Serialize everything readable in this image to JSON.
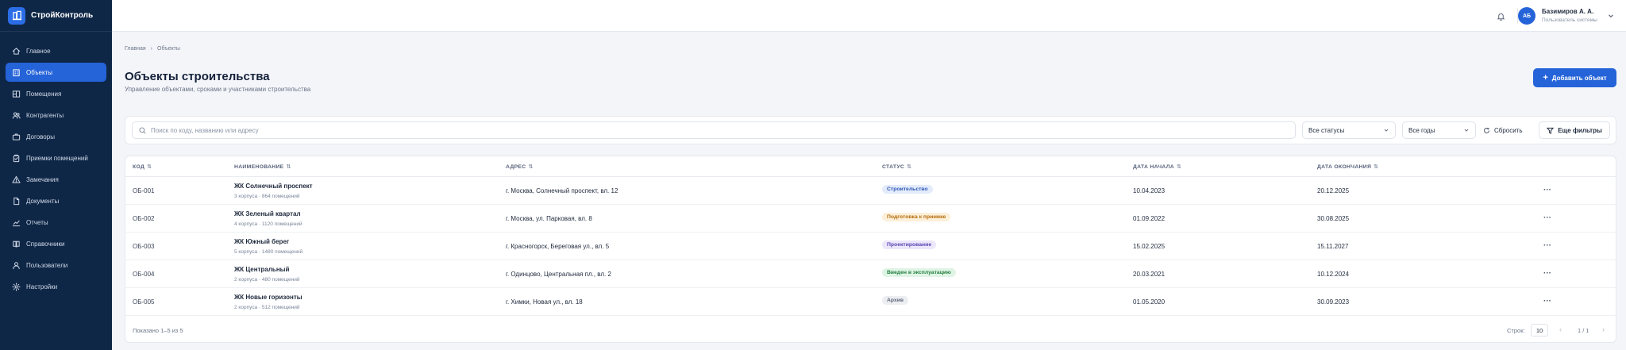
{
  "app": {
    "brand": "СтройКонтроль"
  },
  "sidebar": {
    "items": [
      {
        "label": "Главное",
        "icon": "home-icon"
      },
      {
        "label": "Объекты",
        "icon": "building-icon",
        "active": true
      },
      {
        "label": "Помещения",
        "icon": "rooms-icon"
      },
      {
        "label": "Контрагенты",
        "icon": "users-icon"
      },
      {
        "label": "Договоры",
        "icon": "briefcase-icon"
      },
      {
        "label": "Приемки помещений",
        "icon": "clipboard-icon"
      },
      {
        "label": "Замечания",
        "icon": "warning-icon"
      },
      {
        "label": "Документы",
        "icon": "document-icon"
      },
      {
        "label": "Отчеты",
        "icon": "chart-icon"
      },
      {
        "label": "Справочники",
        "icon": "book-icon"
      },
      {
        "label": "Пользователи",
        "icon": "user-icon"
      },
      {
        "label": "Настройки",
        "icon": "gear-icon"
      }
    ]
  },
  "header": {
    "user": {
      "initials": "АБ",
      "name": "Базимиров А. А.",
      "role": "Пользователь системы"
    }
  },
  "breadcrumb": [
    "Главная",
    "Объекты"
  ],
  "page": {
    "title": "Объекты строительства",
    "subtitle": "Управление объектами, сроками и участниками строительства",
    "add_label": "Добавить объект"
  },
  "filters": {
    "search_placeholder": "Поиск по коду, названию или адресу",
    "status": "Все статусы",
    "year": "Все годы",
    "reset_label": "Сбросить",
    "more_label": "Еще фильтры"
  },
  "table": {
    "columns": [
      "КОД",
      "НАИМЕНОВАНИЕ",
      "АДРЕС",
      "СТАТУС",
      "ДАТА НАЧАЛА",
      "ДАТА ОКОНЧАНИЯ"
    ],
    "rows": [
      {
        "code": "ОБ-001",
        "name": "ЖК Солнечный проспект",
        "sub": "3 корпуса · 864 помещений",
        "address": "г. Москва, Солнечный проспект, вл. 12",
        "status": "Строительство",
        "start": "10.04.2023",
        "end": "20.12.2025"
      },
      {
        "code": "ОБ-002",
        "name": "ЖК Зеленый квартал",
        "sub": "4 корпуса · 1120 помещений",
        "address": "г. Москва, ул. Парковая, вл. 8",
        "status": "Подготовка к приемке",
        "start": "01.09.2022",
        "end": "30.08.2025"
      },
      {
        "code": "ОБ-003",
        "name": "ЖК Южный берег",
        "sub": "5 корпуса · 1480 помещений",
        "address": "г. Красногорск, Береговая ул., вл. 5",
        "status": "Проектирование",
        "start": "15.02.2025",
        "end": "15.11.2027"
      },
      {
        "code": "ОБ-004",
        "name": "ЖК Центральный",
        "sub": "2 корпуса · 480 помещений",
        "address": "г. Одинцово, Центральная пл., вл. 2",
        "status": "Введен в эксплуатацию",
        "start": "20.03.2021",
        "end": "10.12.2024"
      },
      {
        "code": "ОБ-005",
        "name": "ЖК Новые горизонты",
        "sub": "2 корпуса · 512 помещений",
        "address": "г. Химки, Новая ул., вл. 18",
        "status": "Архив",
        "start": "01.05.2020",
        "end": "30.09.2023"
      }
    ],
    "more_glyph": "···"
  },
  "status_colors": {
    "Строительство": {
      "bg": "#e4ecfb",
      "fg": "#2d58b8"
    },
    "Подготовка к приемке": {
      "bg": "#fdf0d9",
      "fg": "#b56a0b"
    },
    "Проектирование": {
      "bg": "#ece7fb",
      "fg": "#5b44b3"
    },
    "Введен в эксплуатацию": {
      "bg": "#e0f4e6",
      "fg": "#23803f"
    },
    "Архив": {
      "bg": "#eceef2",
      "fg": "#5d6678"
    }
  },
  "footer": {
    "shown": "Показано 1–5 из 5",
    "rows_label": "Строк:",
    "rows_value": "10",
    "pager": "1 / 1"
  }
}
